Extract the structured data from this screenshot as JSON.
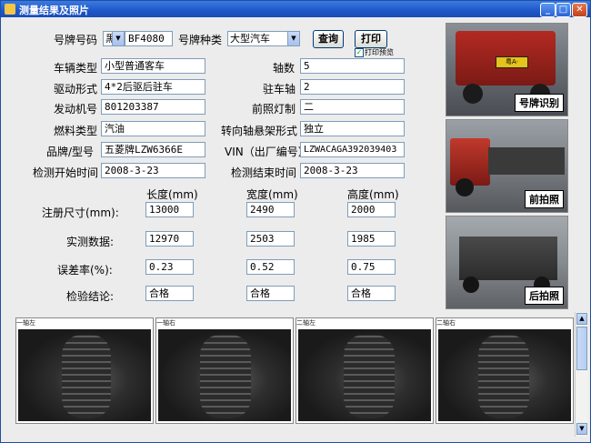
{
  "window": {
    "title": "测量结果及照片"
  },
  "search": {
    "plate_label": "号牌号码",
    "plate_color": "黑",
    "plate_number": "BF4080",
    "plate_type_label": "号牌种类",
    "plate_type": "大型汽车",
    "query_button": "查询",
    "print_button": "打印",
    "print_preview_label": "打印预览",
    "print_preview_checked": true
  },
  "info": {
    "vehicle_type_label": "车辆类型",
    "vehicle_type": "小型普通客车",
    "axles_label": "轴数",
    "axles": "5",
    "drive_label": "驱动形式",
    "drive": "4*2后驱后驻车",
    "parking_axle_label": "驻车轴",
    "parking_axle": "2",
    "engine_label": "发动机号",
    "engine": "801203387",
    "headlight_label": "前照灯制",
    "headlight": "二",
    "fuel_label": "燃料类型",
    "fuel": "汽油",
    "steering_label": "转向轴悬架形式",
    "steering": "独立",
    "brand_label": "品牌/型号",
    "brand": "五菱牌LZW6366E",
    "vin_label": "VIN（出厂编号）",
    "vin": "LZWACAGA392039403",
    "start_label": "检测开始时间",
    "start": "2008-3-23",
    "end_label": "检测结束时间",
    "end": "2008-3-23"
  },
  "dims": {
    "col_length": "长度(mm)",
    "col_width": "宽度(mm)",
    "col_height": "高度(mm)",
    "registered_label": "注册尺寸(mm):",
    "registered": [
      "13000",
      "2490",
      "2000"
    ],
    "measured_label": "实测数据:",
    "measured": [
      "12970",
      "2503",
      "1985"
    ],
    "error_label": "误差率(%):",
    "error": [
      "0.23",
      "0.52",
      "0.75"
    ],
    "conclusion_label": "检验结论:",
    "conclusion": [
      "合格",
      "合格",
      "合格"
    ]
  },
  "photos": {
    "plate_caption": "号牌识别",
    "front_caption": "前拍照",
    "rear_caption": "后拍照",
    "plate_text": "粤A·"
  },
  "wheels": [
    "一轴左",
    "一轴右",
    "二轴左",
    "二轴右"
  ],
  "colors": {
    "titlebar": "#1f57c8",
    "window_bg": "#ececec",
    "field_border": "#7f9db9"
  }
}
